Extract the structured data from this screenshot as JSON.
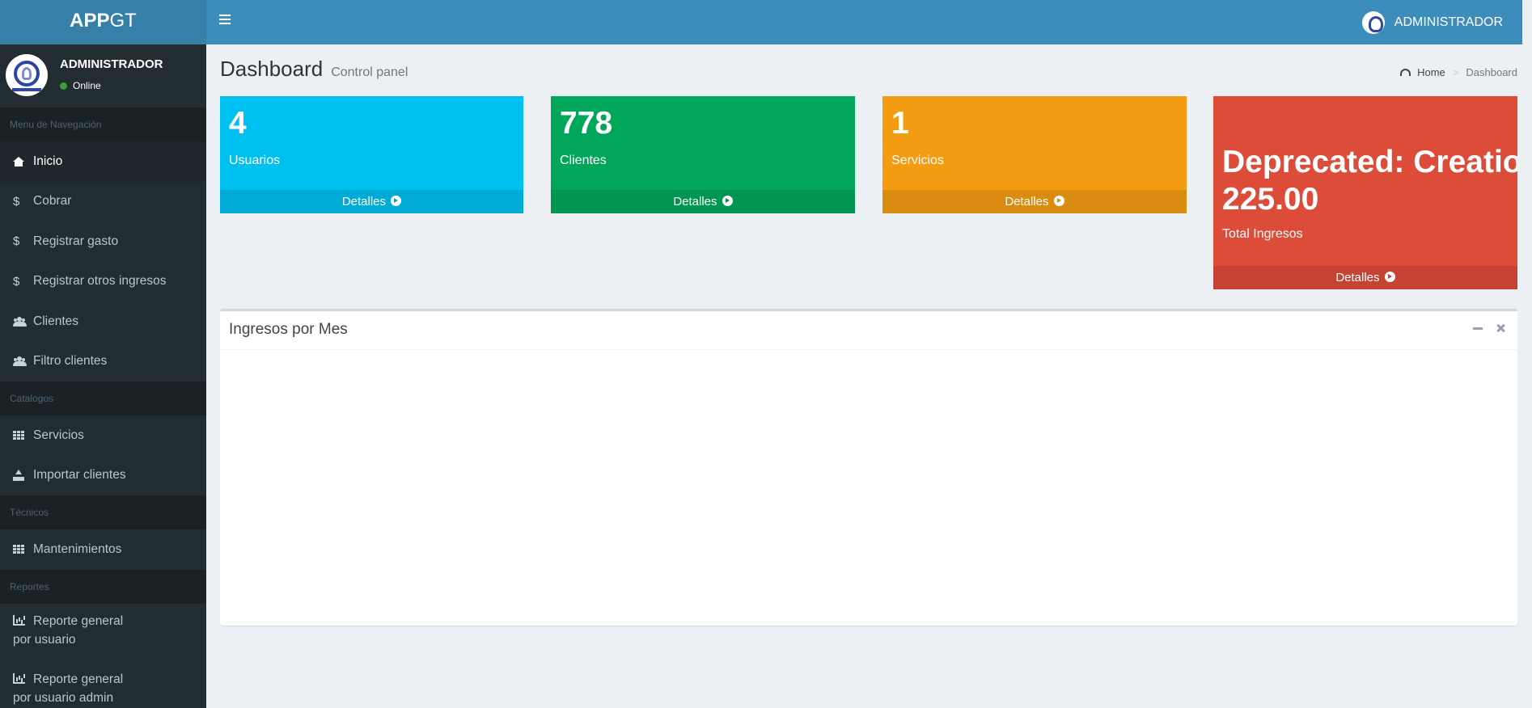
{
  "app": {
    "logo_bold": "APP",
    "logo_light": "GT"
  },
  "topbar": {
    "user_name": "ADMINISTRADOR"
  },
  "user_panel": {
    "name": "ADMINISTRADOR",
    "status": "Online"
  },
  "sidebar": {
    "headers": [
      "Menu de Navegación",
      "Catalogos",
      "Técnicos",
      "Reportes"
    ],
    "items": [
      {
        "label": "Inicio",
        "icon": "home-icon"
      },
      {
        "label": "Cobrar",
        "icon": "dollar-icon"
      },
      {
        "label": "Registrar gasto",
        "icon": "dollar-icon"
      },
      {
        "label": "Registrar otros ingresos",
        "icon": "dollar-icon"
      },
      {
        "label": "Clientes",
        "icon": "users-icon"
      },
      {
        "label": "Filtro clientes",
        "icon": "users-icon"
      },
      {
        "label": "Servicios",
        "icon": "grid-icon"
      },
      {
        "label": "Importar clientes",
        "icon": "upload-icon"
      },
      {
        "label": "Mantenimientos",
        "icon": "grid-icon"
      },
      {
        "label": "Reporte general",
        "label2": "por usuario",
        "icon": "bar-chart-icon"
      },
      {
        "label": "Reporte general",
        "label2": "por usuario admin",
        "icon": "bar-chart-icon"
      }
    ]
  },
  "page": {
    "title": "Dashboard",
    "subtitle": "Control panel",
    "breadcrumb": {
      "home": "Home",
      "current": "Dashboard"
    }
  },
  "stats": [
    {
      "value": "4",
      "label": "Usuarios",
      "footer": "Detalles",
      "color": "#00c0ef"
    },
    {
      "value": "778",
      "label": "Clientes",
      "footer": "Detalles",
      "color": "#00a65a"
    },
    {
      "value": "1",
      "label": "Servicios",
      "footer": "Detalles",
      "color": "#f39c12"
    },
    {
      "value_line1": "Deprecated: Creatio",
      "value_line2": "225.00",
      "label": "Total Ingresos",
      "footer": "Detalles",
      "color": "#dd4b39"
    }
  ],
  "panel": {
    "title": "Ingresos por Mes"
  }
}
